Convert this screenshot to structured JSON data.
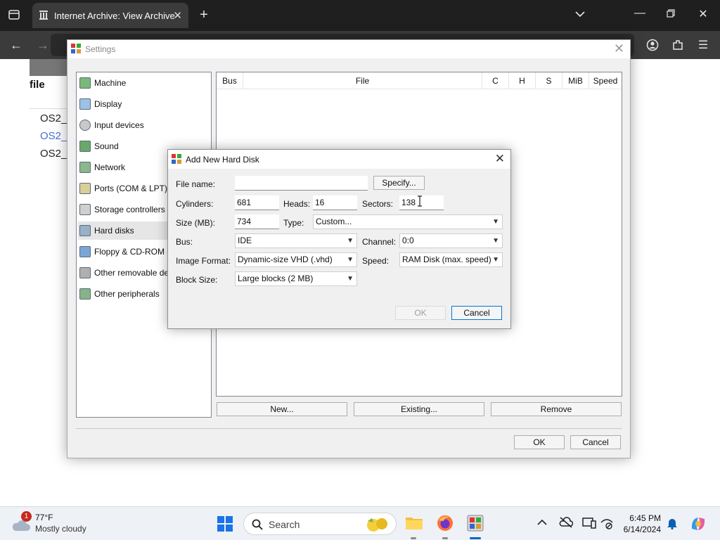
{
  "browser": {
    "tab_title": "Internet Archive: View Archive"
  },
  "page_behind": {
    "column_header": "file",
    "rows": [
      "OS2_",
      "OS2_",
      "OS2_"
    ]
  },
  "settings": {
    "title": "Settings",
    "categories": [
      {
        "label": "Machine",
        "icon": "machine-icon"
      },
      {
        "label": "Display",
        "icon": "display-icon"
      },
      {
        "label": "Input devices",
        "icon": "input-devices-icon"
      },
      {
        "label": "Sound",
        "icon": "sound-icon"
      },
      {
        "label": "Network",
        "icon": "network-icon"
      },
      {
        "label": "Ports (COM & LPT)",
        "icon": "ports-icon"
      },
      {
        "label": "Storage controllers",
        "icon": "storage-controllers-icon"
      },
      {
        "label": "Hard disks",
        "icon": "hard-disks-icon"
      },
      {
        "label": "Floppy & CD-ROM drives",
        "icon": "floppy-cdrom-icon"
      },
      {
        "label": "Other removable devices",
        "icon": "removable-devices-icon"
      },
      {
        "label": "Other peripherals",
        "icon": "peripherals-icon"
      }
    ],
    "selected_category": "Hard disks",
    "disk_columns": [
      "Bus",
      "File",
      "C",
      "H",
      "S",
      "MiB",
      "Speed"
    ],
    "buttons": {
      "new": "New...",
      "existing": "Existing...",
      "remove": "Remove",
      "ok": "OK",
      "cancel": "Cancel"
    }
  },
  "dialog": {
    "title": "Add New Hard Disk",
    "file_name": {
      "label": "File name:",
      "value": ""
    },
    "specify": "Specify...",
    "cylinders": {
      "label": "Cylinders:",
      "value": "681"
    },
    "heads": {
      "label": "Heads:",
      "value": "16"
    },
    "sectors": {
      "label": "Sectors:",
      "value": "138"
    },
    "size": {
      "label": "Size (MB):",
      "value": "734"
    },
    "type": {
      "label": "Type:",
      "value": "Custom..."
    },
    "bus": {
      "label": "Bus:",
      "value": "IDE"
    },
    "channel": {
      "label": "Channel:",
      "value": "0:0"
    },
    "image_format": {
      "label": "Image Format:",
      "value": "Dynamic-size VHD (.vhd)"
    },
    "speed": {
      "label": "Speed:",
      "value": "RAM Disk (max. speed)"
    },
    "block_size": {
      "label": "Block Size:",
      "value": "Large blocks (2 MB)"
    },
    "ok": "OK",
    "cancel": "Cancel"
  },
  "taskbar": {
    "weather_temp": "77°F",
    "weather_desc": "Mostly cloudy",
    "weather_badge": "1",
    "search_placeholder": "Search",
    "time": "6:45 PM",
    "date": "6/14/2024"
  },
  "colors": {
    "accent": "#0078d7",
    "tab_bar": "#1f1f1f",
    "selection": "#e6e6e6"
  }
}
